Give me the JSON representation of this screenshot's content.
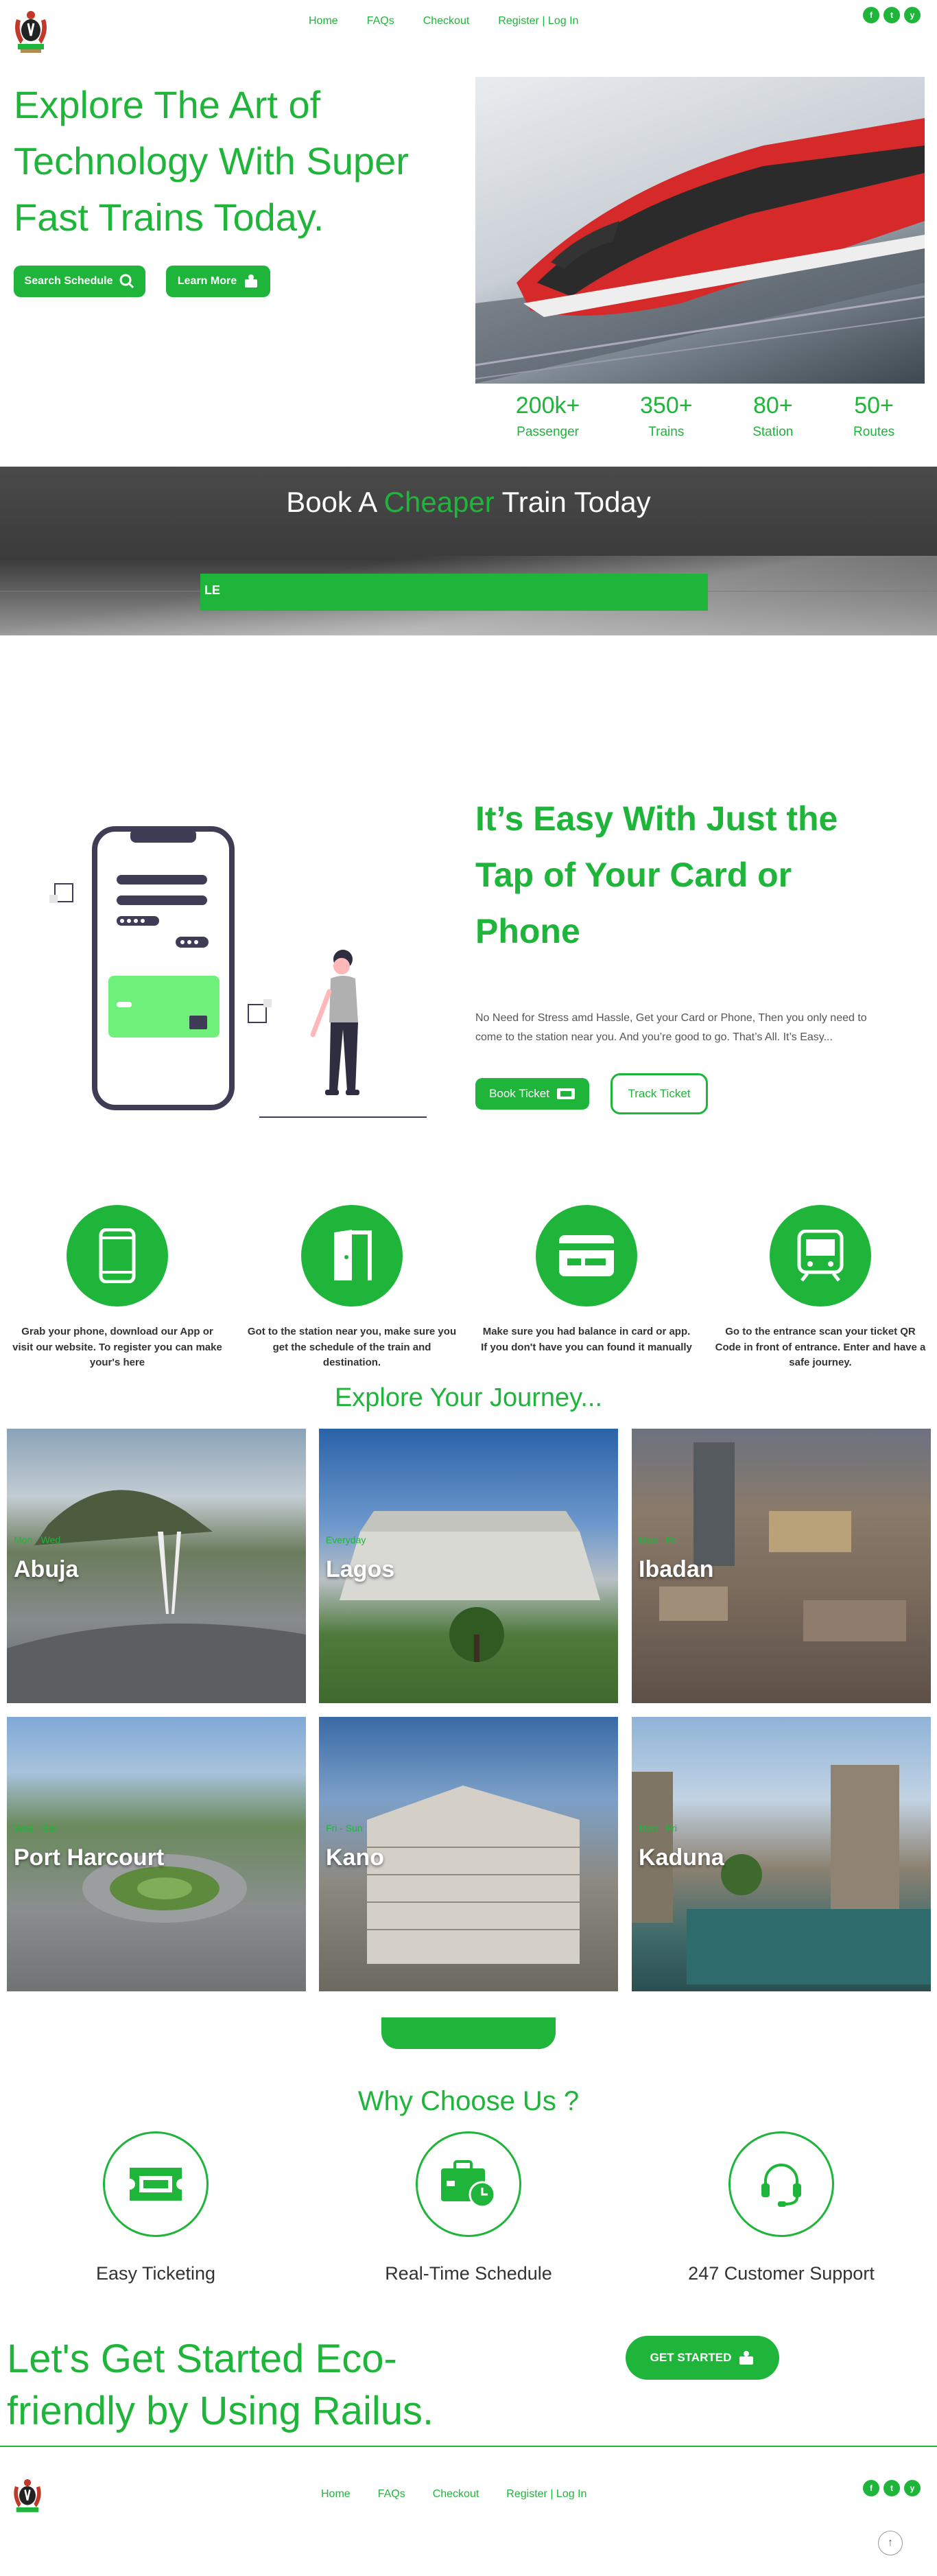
{
  "header": {
    "logo": "coat-of-arms",
    "nav": [
      "Home",
      "FAQs",
      "Checkout",
      "Register | Log In"
    ],
    "social": [
      "f",
      "t",
      "y"
    ]
  },
  "hero": {
    "title_line1": "Explore The Art of",
    "title_line2": "Technology With Super",
    "title_line3": "Fast Trains Today.",
    "search_button": "Search Schedule",
    "learn_button": "Learn More",
    "stats": [
      {
        "value": "200k+",
        "label": "Passenger"
      },
      {
        "value": "350+",
        "label": "Trains"
      },
      {
        "value": "80+",
        "label": "Station"
      },
      {
        "value": "50+",
        "label": "Routes"
      }
    ]
  },
  "book": {
    "title_pre": "Book A ",
    "title_accent": "Cheaper",
    "title_post": " Train Today",
    "bar_text": "LE"
  },
  "easy": {
    "title_line1": "It’s Easy With Just the",
    "title_line2": "Tap of Your Card or",
    "title_line3": "Phone",
    "description_line1": "No Need for Stress amd Hassle, Get your Card or Phone, Then you only need to",
    "description_line2": "come to the station near you. And you’re good to go. That’s All. It’s Easy...",
    "book_button": "Book Ticket",
    "track_button": "Track Ticket"
  },
  "steps": [
    {
      "icon": "phone-icon",
      "line1": "Grab your phone, download our App or",
      "line2": "visit our website. To register you can make",
      "line3": "your's here"
    },
    {
      "icon": "door-icon",
      "line1": "Got to the station near you, make sure you",
      "line2": "get the schedule of the train and",
      "line3": "destination."
    },
    {
      "icon": "card-icon",
      "line1": "Make sure you had balance in card or app.",
      "line2": "If you don't have you can found it manually",
      "line3": ""
    },
    {
      "icon": "train-icon",
      "line1": "Go to the entrance scan your ticket QR",
      "line2": "Code in front of entrance. Enter and have a",
      "line3": "safe journey."
    }
  ],
  "explore": {
    "title": "Explore Your Journey...",
    "cities": [
      {
        "name": "Abuja",
        "days": "Mon - Wed"
      },
      {
        "name": "Lagos",
        "days": "Everyday"
      },
      {
        "name": "Ibadan",
        "days": "Mon - Fri"
      },
      {
        "name": "Port Harcourt",
        "days": "Wed - Sat"
      },
      {
        "name": "Kano",
        "days": "Fri - Sun"
      },
      {
        "name": "Kaduna",
        "days": "Mon - Fri"
      }
    ]
  },
  "why": {
    "title": "Why Choose Us ?",
    "items": [
      {
        "icon": "ticket-icon",
        "label": "Easy Ticketing"
      },
      {
        "icon": "schedule-icon",
        "label": "Real-Time Schedule"
      },
      {
        "icon": "headset-icon",
        "label": "247 Customer Support"
      }
    ]
  },
  "cta": {
    "title_line1": "Let's Get Started Eco-",
    "title_line2": "friendly by Using Railus.",
    "button": "GET STARTED"
  },
  "footer": {
    "nav": [
      "Home",
      "FAQs",
      "Checkout",
      "Register | Log In"
    ],
    "social": [
      "f",
      "t",
      "y"
    ],
    "scroll_top": "↑"
  },
  "colors": {
    "accent": "#1fb53b",
    "dark": "#333333"
  }
}
